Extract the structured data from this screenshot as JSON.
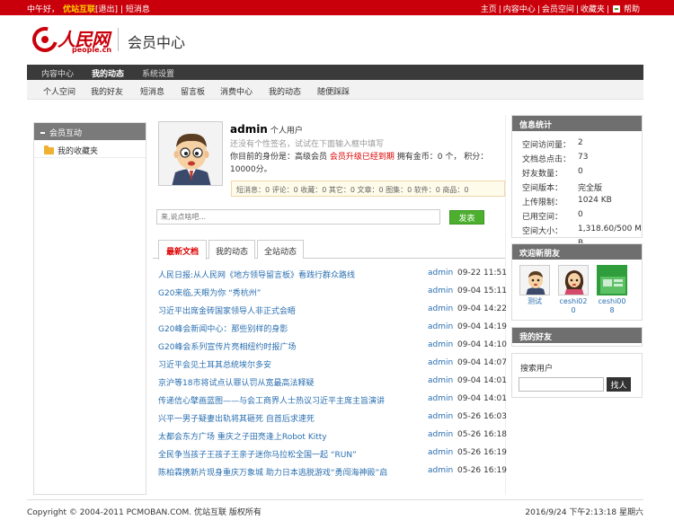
{
  "topbar": {
    "greeting": "中午好，",
    "username": "优站互联",
    "logout": "[退出]",
    "messages": "短消息",
    "links": [
      "主页",
      "内容中心",
      "会员空间",
      "收藏夹"
    ],
    "help": "帮助"
  },
  "header": {
    "logo_cn": "人民网",
    "logo_en": "people.cn",
    "site_title": "会员中心"
  },
  "main_nav": [
    "内容中心",
    "我的动态",
    "系统设置"
  ],
  "main_nav_active": "我的动态",
  "sub_nav": [
    "个人空间",
    "我的好友",
    "短消息",
    "留言板",
    "消费中心",
    "我的动态",
    "随便踩踩"
  ],
  "sidebar": {
    "section_title": "会员互动",
    "items": [
      "我的收藏夹"
    ]
  },
  "profile": {
    "name": "admin",
    "role": "个人用户",
    "signature": "还没有个性签名，试试在下面输入框中填写",
    "identity_prefix": "你目前的身份是：高级会员 ",
    "upgrade_notice": "会员升级已经到期",
    "gold_line": " 拥有金币：0 个，  积分：10000分。",
    "stats": "短消息：0 评论：0 收藏：0 其它：0 文章：0 图集：0 软件：0 商品：0"
  },
  "status_box": {
    "placeholder": "来,说点啥吧...",
    "button": "发表"
  },
  "tabs": [
    "最新文档",
    "我的动态",
    "全站动态"
  ],
  "articles": [
    {
      "title": "人民日报:从人民网《地方领导留言板》看践行群众路线",
      "author": "admin",
      "date": "09-22 11:51"
    },
    {
      "title": "G20来临,天眼为你 “秀杭州”",
      "author": "admin",
      "date": "09-04 15:11"
    },
    {
      "title": "习近平出席金砖国家领导人非正式会晤",
      "author": "admin",
      "date": "09-04 14:22"
    },
    {
      "title": "G20峰会新闻中心：那些别样的身影",
      "author": "admin",
      "date": "09-04 14:19"
    },
    {
      "title": "G20峰会系列宣传片亮相纽约时报广场",
      "author": "admin",
      "date": "09-04 14:10"
    },
    {
      "title": "习近平会见土耳其总统埃尔多安",
      "author": "admin",
      "date": "09-04 14:07"
    },
    {
      "title": "京沪等18市将试点认罪认罚从宽最高法释疑",
      "author": "admin",
      "date": "09-04 14:01"
    },
    {
      "title": "传递信心擘画蓝图——与会工商界人士热议习近平主席主旨演讲",
      "author": "admin",
      "date": "09-04 14:01"
    },
    {
      "title": "兴平一男子疑妻出轨将其砸死 自首后求速死",
      "author": "admin",
      "date": "05-26 16:03"
    },
    {
      "title": "太都会东方广场 重庆之子田亮逢上Robot Kitty",
      "author": "admin",
      "date": "05-26 16:18"
    },
    {
      "title": "全民争当孩子王孩子王亲子迷你马拉松全国一起 “RUN”",
      "author": "admin",
      "date": "05-26 16:19"
    },
    {
      "title": "陈柏霖携新片现身重庆万象城 助力日本逃脱游戏“勇闯海神殿”启",
      "author": "admin",
      "date": "05-26 16:19"
    }
  ],
  "info_stats": {
    "title": "信息统计",
    "rows": [
      {
        "k": "空间访问量：",
        "v": "2"
      },
      {
        "k": "文档总点击：",
        "v": "73"
      },
      {
        "k": "好友数量：",
        "v": "0"
      },
      {
        "k": "空间版本：",
        "v": "完全版"
      },
      {
        "k": "上传限制：",
        "v": "1024 KB"
      },
      {
        "k": "已用空间：",
        "v": "0"
      },
      {
        "k": "空间大小：",
        "v": "1,318.60/500 M"
      },
      {
        "k": "",
        "v": "B"
      }
    ]
  },
  "new_friends": {
    "title": "欢迎新朋友",
    "friends": [
      {
        "name": "测试"
      },
      {
        "name": "ceshi02\n0"
      },
      {
        "name": "ceshi00\n8",
        "avatar_text": "会员模板"
      }
    ]
  },
  "my_friends": {
    "title": "我的好友"
  },
  "search_user": {
    "label": "搜索用户",
    "button": "找人"
  },
  "footer": {
    "copyright": "Copyright © 2004-2011 PCMOBAN.COM. 优站互联 版权所有",
    "datetime": "2016/9/24 下午2:13:18 星期六"
  },
  "colors": {
    "brand_red": "#c9000b",
    "link_blue": "#2a6fb0",
    "button_green": "#4caf2e"
  }
}
